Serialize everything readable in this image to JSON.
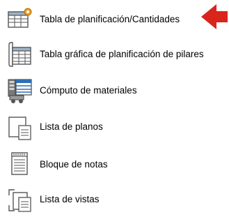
{
  "menu": {
    "items": [
      {
        "label": "Tabla de planificación/Cantidades",
        "icon": "schedule-quantities-icon"
      },
      {
        "label": "Tabla gráfica de planificación de pilares",
        "icon": "graphical-column-schedule-icon"
      },
      {
        "label": "Cómputo de materiales",
        "icon": "material-takeoff-icon"
      },
      {
        "label": "Lista de planos",
        "icon": "sheet-list-icon"
      },
      {
        "label": "Bloque de notas",
        "icon": "note-block-icon"
      },
      {
        "label": "Lista de vistas",
        "icon": "view-list-icon"
      }
    ]
  },
  "colors": {
    "pointer_arrow": "#d9251c",
    "icon_blue": "#2f6fb5",
    "icon_grey": "#555555",
    "icon_orange": "#f0a020"
  },
  "pointer": {
    "icon": "red-pointer-arrow-icon"
  }
}
